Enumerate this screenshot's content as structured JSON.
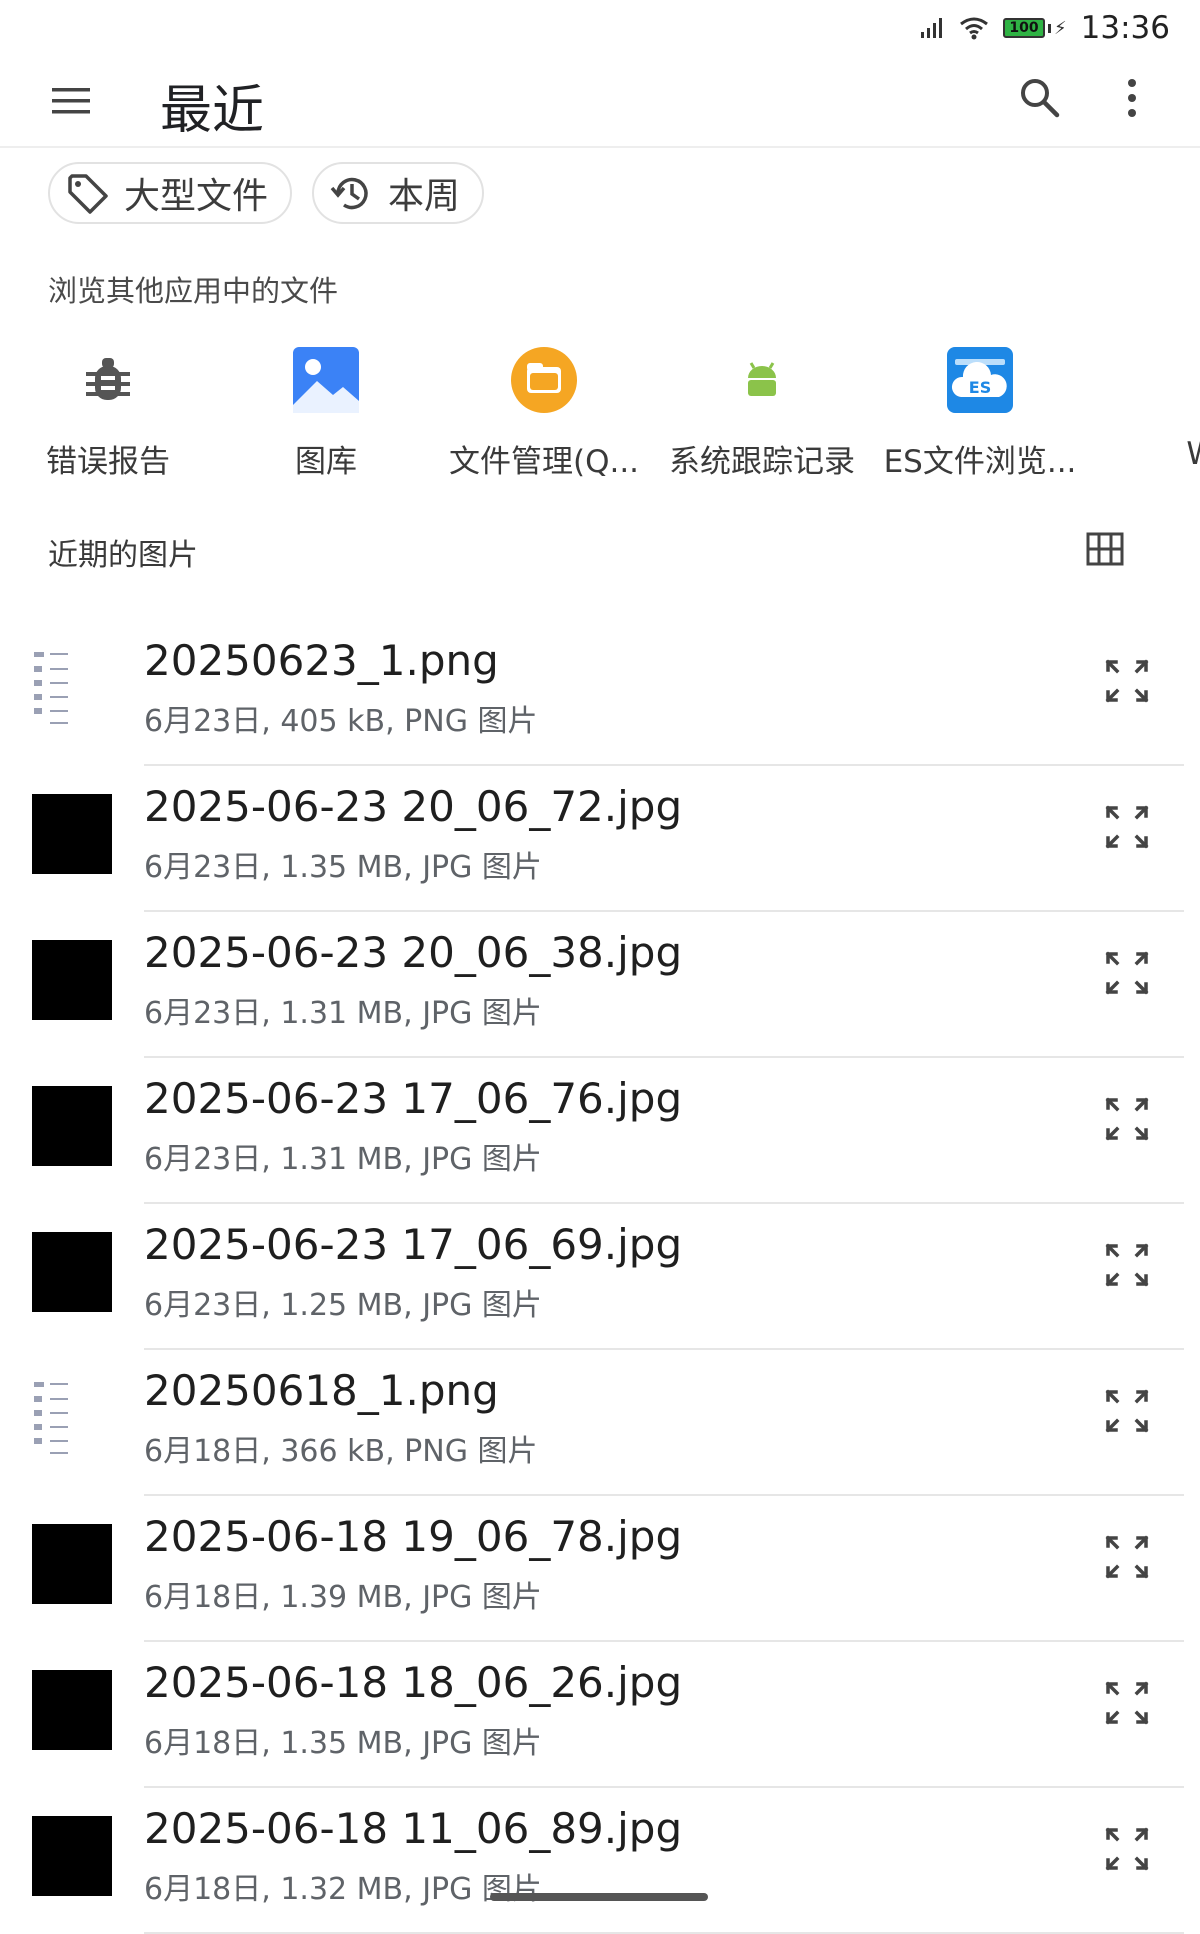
{
  "status_bar": {
    "time": "13:36",
    "battery": "100"
  },
  "app_bar": {
    "title": "最近"
  },
  "chips": [
    {
      "label": "大型文件",
      "icon": "tag-icon"
    },
    {
      "label": "本周",
      "icon": "history-icon"
    }
  ],
  "apps_section": {
    "title": "浏览其他应用中的文件",
    "apps": [
      {
        "label": "错误报告",
        "icon": "bug-icon"
      },
      {
        "label": "图库",
        "icon": "gallery-icon"
      },
      {
        "label": "文件管理(Q...",
        "icon": "folder-app-icon"
      },
      {
        "label": "系统跟踪记录",
        "icon": "android-icon"
      },
      {
        "label": "ES文件浏览...",
        "icon": "es-cloud-icon"
      },
      {
        "label": "WPS O",
        "icon": "wps-icon"
      }
    ]
  },
  "recent_section": {
    "title": "近期的图片"
  },
  "files": [
    {
      "name": "20250623_1.png",
      "meta": "6月23日, 405 kB, PNG 图片",
      "thumb": "screenshot"
    },
    {
      "name": "2025-06-23 20_06_72.jpg",
      "meta": "6月23日, 1.35 MB, JPG 图片",
      "thumb": "black"
    },
    {
      "name": "2025-06-23 20_06_38.jpg",
      "meta": "6月23日, 1.31 MB, JPG 图片",
      "thumb": "black"
    },
    {
      "name": "2025-06-23 17_06_76.jpg",
      "meta": "6月23日, 1.31 MB, JPG 图片",
      "thumb": "black"
    },
    {
      "name": "2025-06-23 17_06_69.jpg",
      "meta": "6月23日, 1.25 MB, JPG 图片",
      "thumb": "black"
    },
    {
      "name": "20250618_1.png",
      "meta": "6月18日, 366 kB, PNG 图片",
      "thumb": "screenshot"
    },
    {
      "name": "2025-06-18 19_06_78.jpg",
      "meta": "6月18日, 1.39 MB, JPG 图片",
      "thumb": "black"
    },
    {
      "name": "2025-06-18 18_06_26.jpg",
      "meta": "6月18日, 1.35 MB, JPG 图片",
      "thumb": "black"
    },
    {
      "name": "2025-06-18 11_06_89.jpg",
      "meta": "6月18日, 1.32 MB, JPG 图片",
      "thumb": "black"
    }
  ]
}
